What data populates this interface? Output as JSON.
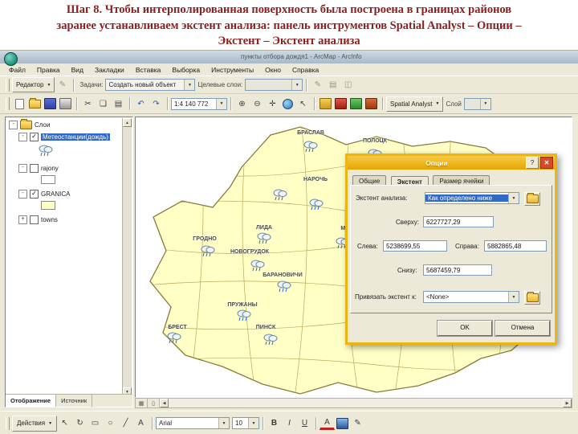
{
  "slide_title": {
    "lines": [
      "Шаг 8. Чтобы интерполированная поверхность была построена в границах районов",
      "заранее устанавливаем экстент анализа: панель инструментов Spatial Analyst – Опции –",
      "Экстент – Экстент анализа"
    ]
  },
  "window": {
    "title": "пункты отбора дождя1 - ArcMap - ArcInfo"
  },
  "menu": {
    "items": [
      "Файл",
      "Правка",
      "Вид",
      "Закладки",
      "Вставка",
      "Выборка",
      "Инструменты",
      "Окно",
      "Справка"
    ]
  },
  "editor_toolbar": {
    "label": "Редактор",
    "tasks_label": "Задачи:",
    "task_value": "Создать новый объект",
    "target_label": "Целевые слои:"
  },
  "standard_toolbar": {
    "scale": "1:4 140 772"
  },
  "spatial_toolbar": {
    "label": "Spatial Analyst",
    "layer_label": "Слой"
  },
  "toc": {
    "root": "Слои",
    "items": [
      {
        "label": "Метеостанции(дождь)",
        "checked": true,
        "selected": true
      },
      {
        "label": "rajony",
        "checked": false,
        "selected": false
      },
      {
        "label": "GRANICA",
        "checked": true,
        "selected": false
      },
      {
        "label": "towns",
        "checked": false,
        "selected": false
      }
    ],
    "tabs": [
      "Отображение",
      "Источник"
    ]
  },
  "map": {
    "labels": [
      {
        "name": "БРАСЛАВ"
      },
      {
        "name": "ПОЛОЦК"
      },
      {
        "name": "НАРОЧЬ"
      },
      {
        "name": "ЛИДА"
      },
      {
        "name": "МИНСК"
      },
      {
        "name": "ГРОДНО"
      },
      {
        "name": "НОВОГРУДОК"
      },
      {
        "name": "БАРАНОВИЧИ"
      },
      {
        "name": "ПРУЖАНЫ"
      },
      {
        "name": "БРЕСТ"
      },
      {
        "name": "ПИНСК"
      }
    ]
  },
  "dialog": {
    "title": "Опции",
    "tabs": [
      "Общие",
      "Экстент",
      "Размер ячейки"
    ],
    "fields": {
      "extent_label": "Экстент анализа:",
      "extent_value": "Как определено ниже",
      "top_label": "Сверху:",
      "top_value": "6227727,29",
      "left_label": "Слева:",
      "left_value": "5238699,55",
      "right_label": "Справа:",
      "right_value": "5882865,48",
      "bottom_label": "Снизу:",
      "bottom_value": "5687459,79",
      "snap_label": "Привязать экстент к:",
      "snap_value": "<None>"
    },
    "buttons": {
      "ok": "OK",
      "cancel": "Отмена"
    }
  },
  "draw_toolbar": {
    "actions": "Действия",
    "font": "Arial",
    "size": "10",
    "bold": "B",
    "italic": "I",
    "underline": "U"
  },
  "colors": {
    "accent_gold": "#edb510",
    "selection_blue": "#316ac5",
    "land_yellow": "#ffffc6",
    "title_red": "#8b2020"
  }
}
